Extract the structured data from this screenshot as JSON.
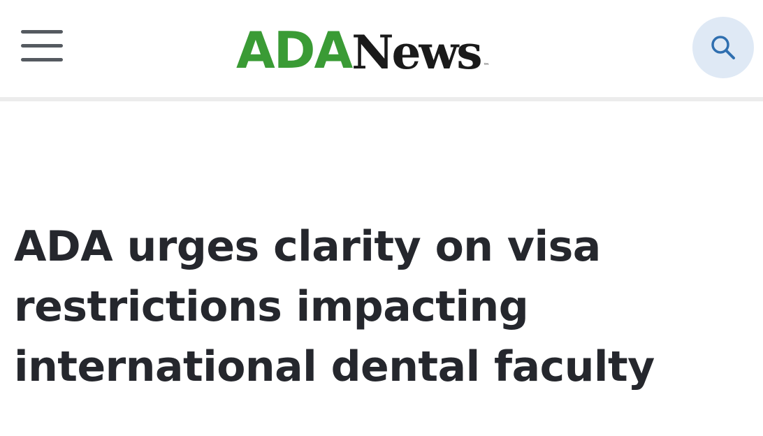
{
  "header": {
    "logo": {
      "part1": "ADA",
      "part2": "News",
      "trademark": "™",
      "part1_color": "#3a9b35",
      "part2_color": "#1a1a1a"
    },
    "menu_icon": "hamburger-menu-icon",
    "search_icon": "search-icon",
    "search_button_bg": "#dfe9f5",
    "search_icon_color": "#2f6fb0"
  },
  "article": {
    "headline_lines": [
      "ADA urges clarity on visa",
      "restrictions impacting",
      "international dental faculty"
    ],
    "headline_color": "#25272d"
  }
}
